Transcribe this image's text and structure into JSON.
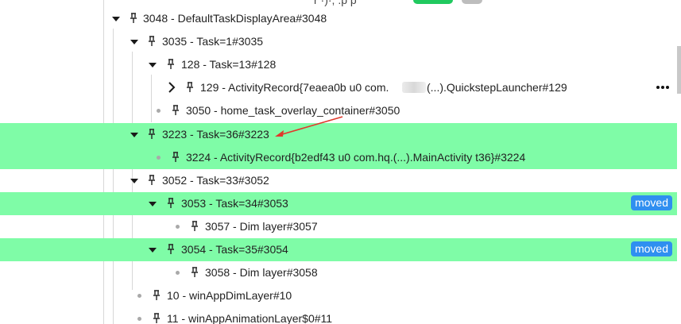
{
  "rows": {
    "r0": {
      "label": "3048 - DefaultTaskDisplayArea#3048"
    },
    "r1": {
      "label": "3035 - Task=1#3035"
    },
    "r2": {
      "label": "128 - Task=13#128"
    },
    "r3": {
      "label": "129 - ActivityRecord{7eaea0b u0 com.",
      "label_tail": "(...).QuickstepLauncher#129"
    },
    "r4": {
      "label": "3050 - home_task_overlay_container#3050"
    },
    "r5": {
      "label": "3223 - Task=36#3223"
    },
    "r6": {
      "label": "3224 - ActivityRecord{b2edf43 u0 com.hq.(...).MainActivity t36}#3224"
    },
    "r7": {
      "label": "3052 - Task=33#3052"
    },
    "r8": {
      "label": "3053 - Task=34#3053",
      "badge": "moved"
    },
    "r9": {
      "label": "3057 - Dim layer#3057"
    },
    "r10": {
      "label": "3054 - Task=35#3054",
      "badge": "moved"
    },
    "r11": {
      "label": "3058 - Dim layer#3058"
    },
    "r12": {
      "label": "10 - winAppDimLayer#10"
    },
    "r13": {
      "label": "11 - winAppAnimationLayer$0#11"
    }
  },
  "colors": {
    "highlight": "#7ffca7",
    "badge": "#2f8ff0",
    "arrow": "#e0392b"
  },
  "icons": {
    "expand": "caret-down-icon",
    "collapsed": "chevron-right-icon",
    "leaf": "dot-icon",
    "pin": "pin-icon",
    "more": "more-options-icon"
  }
}
